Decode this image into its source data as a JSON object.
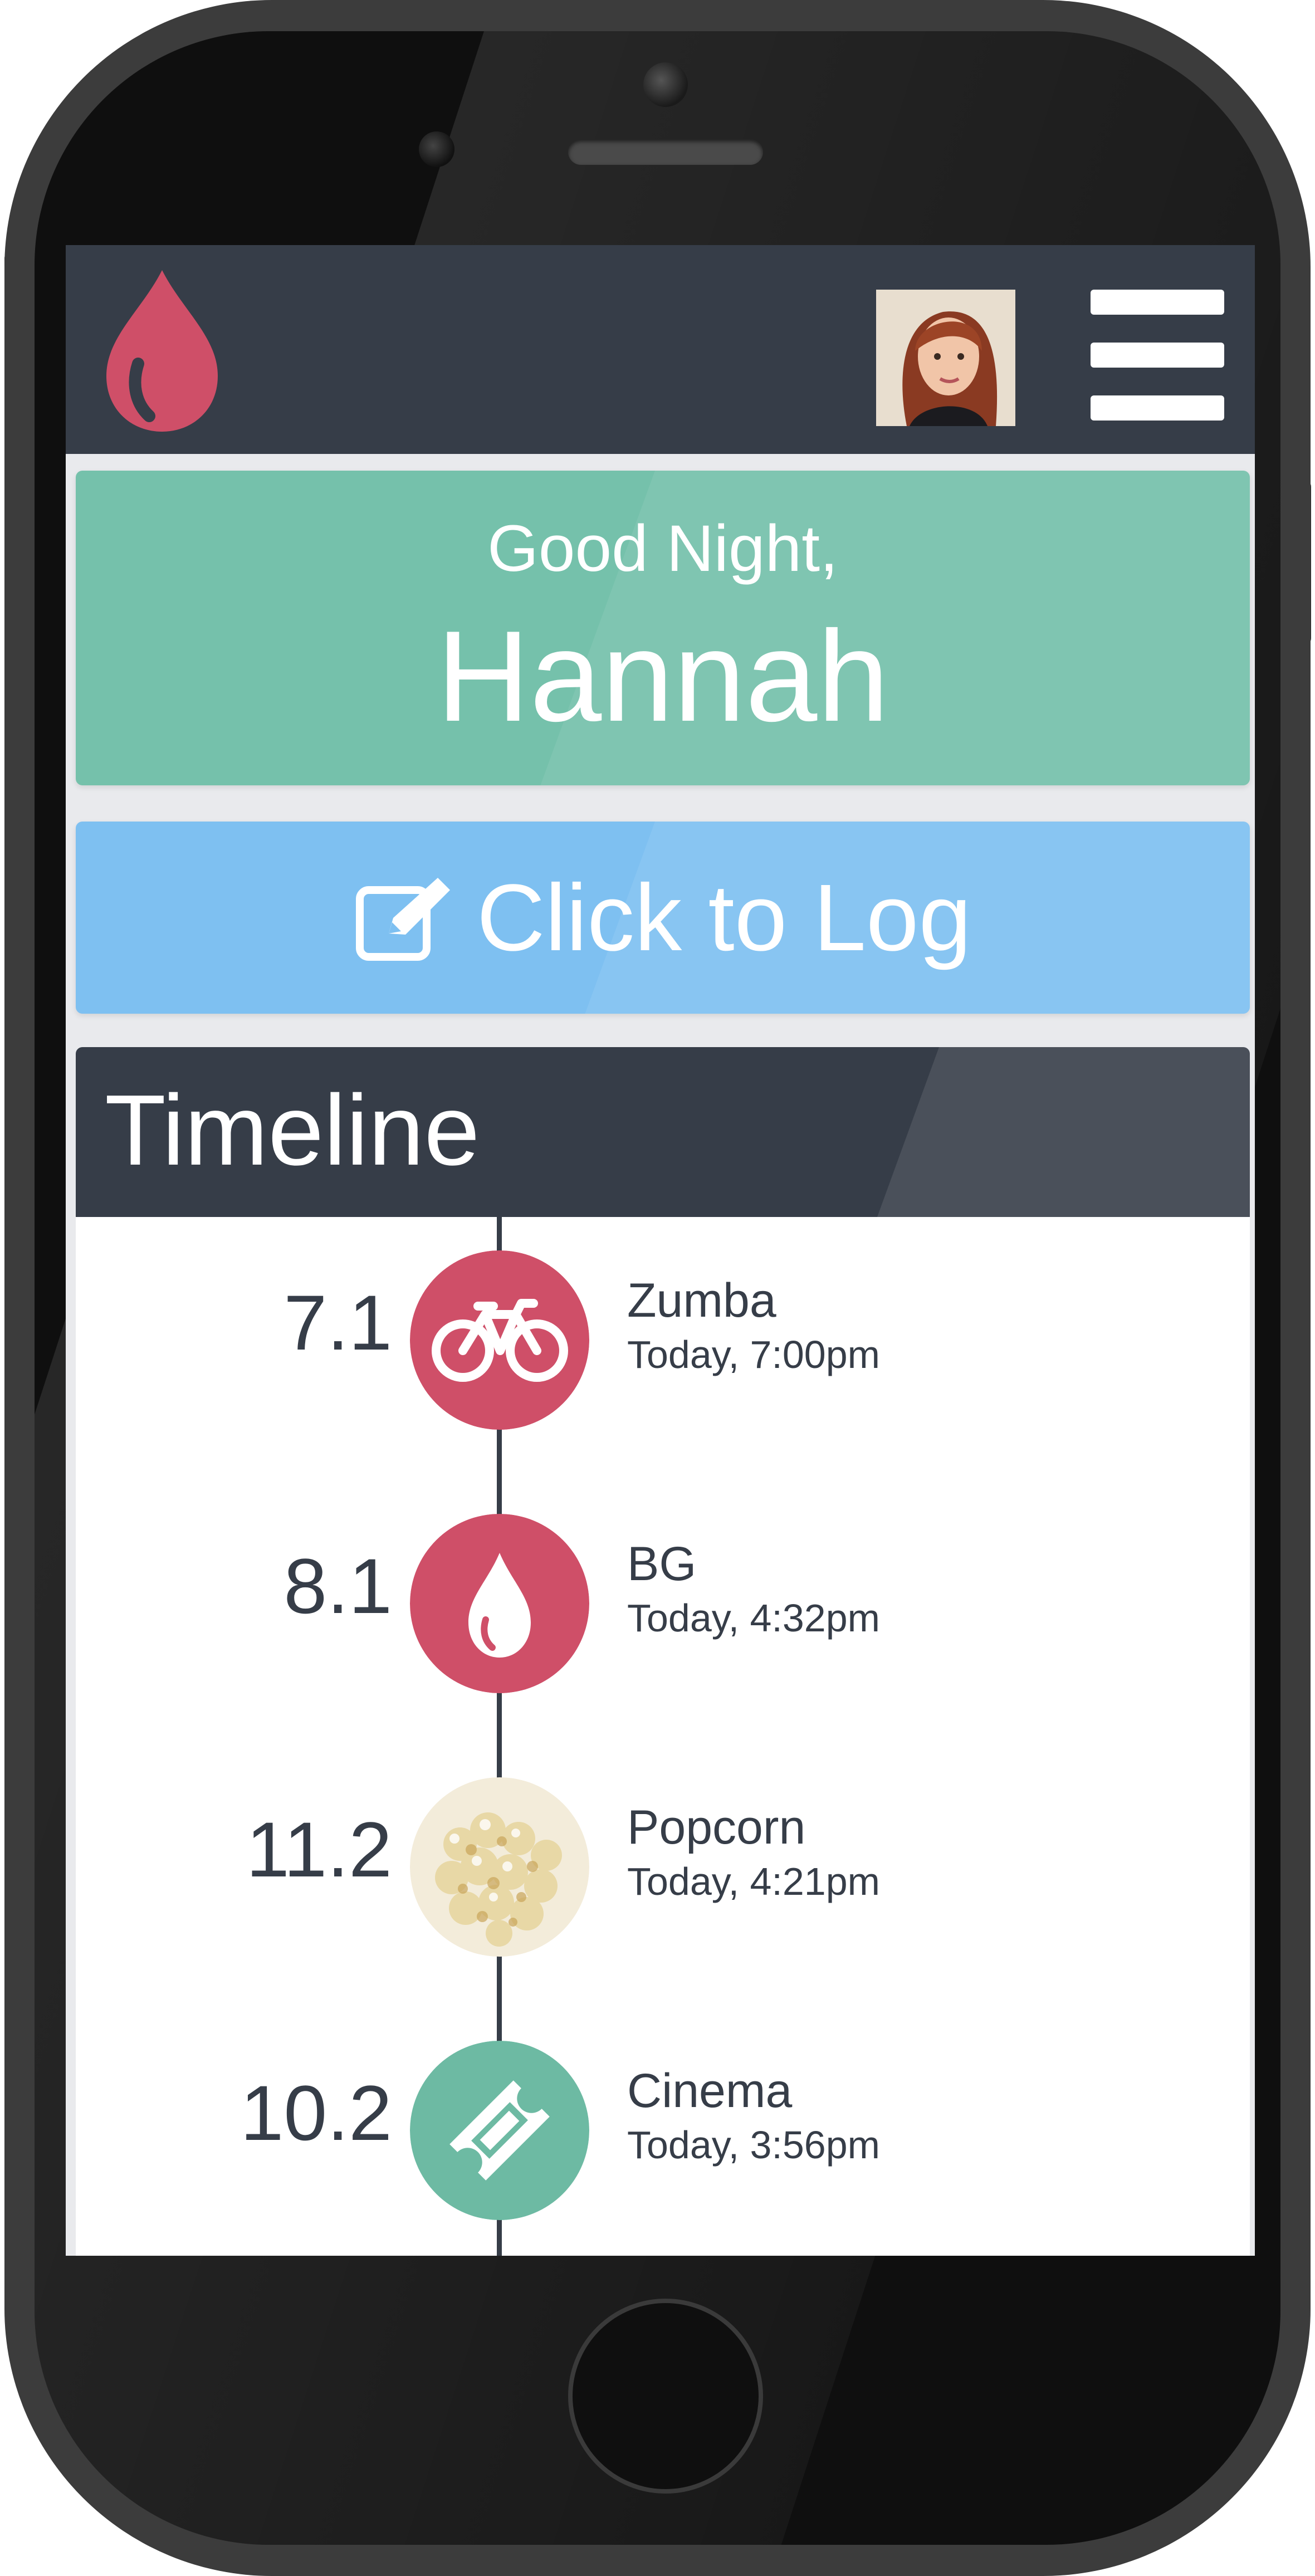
{
  "header": {
    "logo_icon": "blood-drop-icon",
    "avatar_icon": "user-avatar",
    "menu_icon": "hamburger-menu-icon"
  },
  "greeting": {
    "line": "Good Night,",
    "name": "Hannah"
  },
  "log_button": {
    "label": "Click to Log",
    "icon": "edit-icon"
  },
  "timeline": {
    "title": "Timeline",
    "entries": [
      {
        "value": "7.1",
        "title": "Zumba",
        "time": "Today, 7:00pm",
        "icon": "bicycle-icon",
        "badge_color": "#cf4f68"
      },
      {
        "value": "8.1",
        "title": "BG",
        "time": "Today, 4:32pm",
        "icon": "blood-drop-icon",
        "badge_color": "#cf4f68"
      },
      {
        "value": "11.2",
        "title": "Popcorn",
        "time": "Today, 4:21pm",
        "icon": "popcorn-photo",
        "badge_color": "#f1ead8"
      },
      {
        "value": "10.2",
        "title": "Cinema",
        "time": "Today, 3:56pm",
        "icon": "ticket-icon",
        "badge_color": "#6dbaa3"
      }
    ]
  },
  "colors": {
    "header_bg": "#363d48",
    "accent_red": "#cf4f68",
    "greeting_green": "#75c1ab",
    "log_blue": "#7ec0f1",
    "cinema_teal": "#6dbaa3"
  }
}
